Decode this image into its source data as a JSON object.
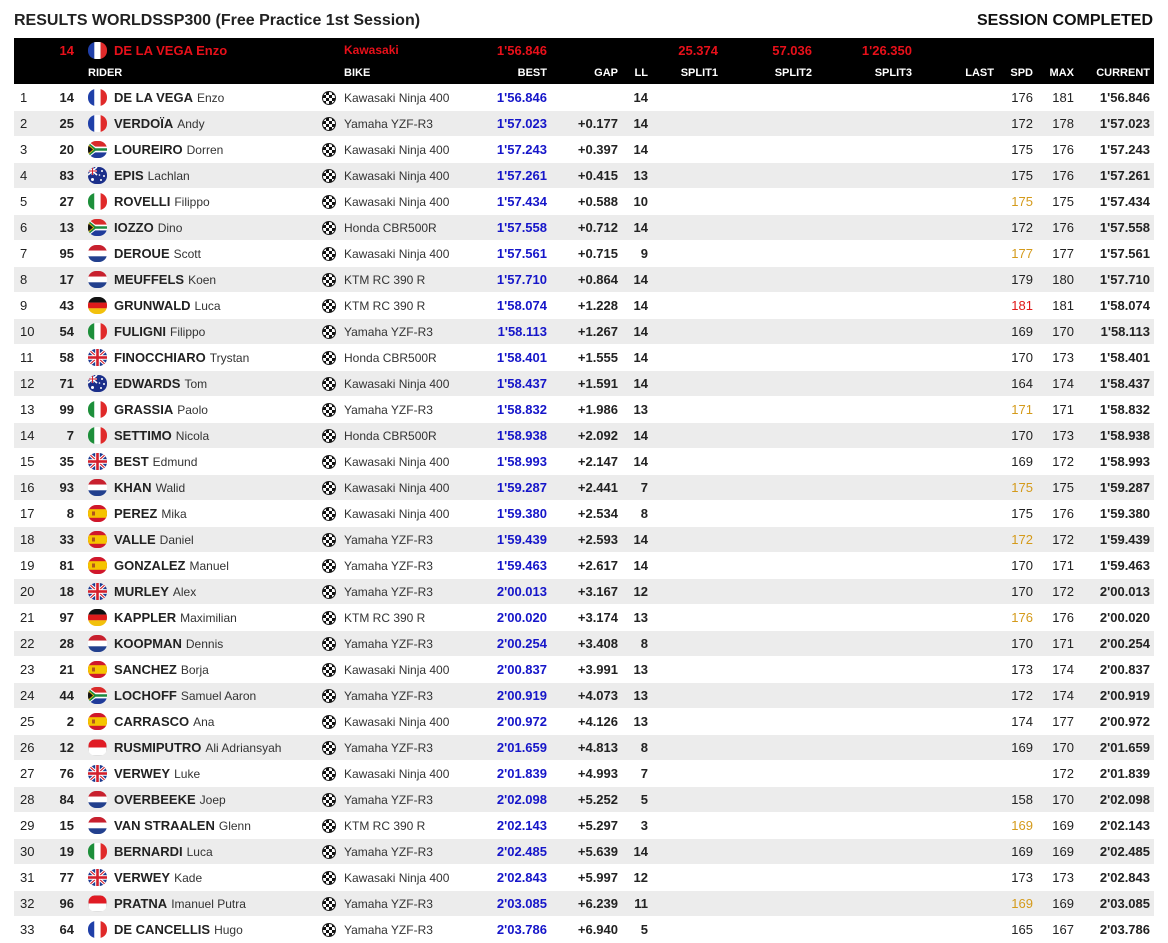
{
  "page": {
    "title": "RESULTS WORLDSSP300 (Free Practice 1st Session)",
    "status": "SESSION COMPLETED"
  },
  "leader": {
    "number": "14",
    "flag": "FRA",
    "rider": "DE LA VEGA Enzo",
    "bike": "Kawasaki",
    "best": "1'56.846",
    "split1": "25.374",
    "split2": "57.036",
    "split3": "1'26.350"
  },
  "columns": {
    "rider": "RIDER",
    "bike": "BIKE",
    "best": "BEST",
    "gap": "GAP",
    "ll": "LL",
    "split1": "SPLIT1",
    "split2": "SPLIT2",
    "split3": "SPLIT3",
    "last": "LAST",
    "spd": "SPD",
    "max": "MAX",
    "current": "CURRENT"
  },
  "colors": {
    "speed_orange": "#d49a1a",
    "speed_red": "#e01818",
    "best_blue": "#1515c9",
    "leader_red": "#e8101a"
  },
  "rows": [
    {
      "pos": "1",
      "num": "14",
      "flag": "FRA",
      "surname": "DE LA VEGA",
      "firstname": "Enzo",
      "bike": "Kawasaki Ninja 400",
      "best": "1'56.846",
      "gap": "",
      "ll": "14",
      "spd": "176",
      "spd_color": "",
      "max": "181",
      "current": "1'56.846"
    },
    {
      "pos": "2",
      "num": "25",
      "flag": "FRA",
      "surname": "VERDOÏA",
      "firstname": "Andy",
      "bike": "Yamaha YZF-R3",
      "best": "1'57.023",
      "gap": "+0.177",
      "ll": "14",
      "spd": "172",
      "spd_color": "",
      "max": "178",
      "current": "1'57.023"
    },
    {
      "pos": "3",
      "num": "20",
      "flag": "RSA",
      "surname": "LOUREIRO",
      "firstname": "Dorren",
      "bike": "Kawasaki Ninja 400",
      "best": "1'57.243",
      "gap": "+0.397",
      "ll": "14",
      "spd": "175",
      "spd_color": "",
      "max": "176",
      "current": "1'57.243"
    },
    {
      "pos": "4",
      "num": "83",
      "flag": "AUS",
      "surname": "EPIS",
      "firstname": "Lachlan",
      "bike": "Kawasaki Ninja 400",
      "best": "1'57.261",
      "gap": "+0.415",
      "ll": "13",
      "spd": "175",
      "spd_color": "",
      "max": "176",
      "current": "1'57.261"
    },
    {
      "pos": "5",
      "num": "27",
      "flag": "ITA",
      "surname": "ROVELLI",
      "firstname": "Filippo",
      "bike": "Kawasaki Ninja 400",
      "best": "1'57.434",
      "gap": "+0.588",
      "ll": "10",
      "spd": "175",
      "spd_color": "orange",
      "max": "175",
      "current": "1'57.434"
    },
    {
      "pos": "6",
      "num": "13",
      "flag": "RSA",
      "surname": "IOZZO",
      "firstname": "Dino",
      "bike": "Honda CBR500R",
      "best": "1'57.558",
      "gap": "+0.712",
      "ll": "14",
      "spd": "172",
      "spd_color": "",
      "max": "176",
      "current": "1'57.558"
    },
    {
      "pos": "7",
      "num": "95",
      "flag": "NED",
      "surname": "DEROUE",
      "firstname": "Scott",
      "bike": "Kawasaki Ninja 400",
      "best": "1'57.561",
      "gap": "+0.715",
      "ll": "9",
      "spd": "177",
      "spd_color": "orange",
      "max": "177",
      "current": "1'57.561"
    },
    {
      "pos": "8",
      "num": "17",
      "flag": "NED",
      "surname": "MEUFFELS",
      "firstname": "Koen",
      "bike": "KTM RC 390 R",
      "best": "1'57.710",
      "gap": "+0.864",
      "ll": "14",
      "spd": "179",
      "spd_color": "",
      "max": "180",
      "current": "1'57.710"
    },
    {
      "pos": "9",
      "num": "43",
      "flag": "GER",
      "surname": "GRUNWALD",
      "firstname": "Luca",
      "bike": "KTM RC 390 R",
      "best": "1'58.074",
      "gap": "+1.228",
      "ll": "14",
      "spd": "181",
      "spd_color": "red",
      "max": "181",
      "current": "1'58.074"
    },
    {
      "pos": "10",
      "num": "54",
      "flag": "ITA",
      "surname": "FULIGNI",
      "firstname": "Filippo",
      "bike": "Yamaha YZF-R3",
      "best": "1'58.113",
      "gap": "+1.267",
      "ll": "14",
      "spd": "169",
      "spd_color": "",
      "max": "170",
      "current": "1'58.113"
    },
    {
      "pos": "11",
      "num": "58",
      "flag": "GBR",
      "surname": "FINOCCHIARO",
      "firstname": "Trystan",
      "bike": "Honda CBR500R",
      "best": "1'58.401",
      "gap": "+1.555",
      "ll": "14",
      "spd": "170",
      "spd_color": "",
      "max": "173",
      "current": "1'58.401"
    },
    {
      "pos": "12",
      "num": "71",
      "flag": "AUS",
      "surname": "EDWARDS",
      "firstname": "Tom",
      "bike": "Kawasaki Ninja 400",
      "best": "1'58.437",
      "gap": "+1.591",
      "ll": "14",
      "spd": "164",
      "spd_color": "",
      "max": "174",
      "current": "1'58.437"
    },
    {
      "pos": "13",
      "num": "99",
      "flag": "ITA",
      "surname": "GRASSIA",
      "firstname": "Paolo",
      "bike": "Yamaha YZF-R3",
      "best": "1'58.832",
      "gap": "+1.986",
      "ll": "13",
      "spd": "171",
      "spd_color": "orange",
      "max": "171",
      "current": "1'58.832"
    },
    {
      "pos": "14",
      "num": "7",
      "flag": "ITA",
      "surname": "SETTIMO",
      "firstname": "Nicola",
      "bike": "Honda CBR500R",
      "best": "1'58.938",
      "gap": "+2.092",
      "ll": "14",
      "spd": "170",
      "spd_color": "",
      "max": "173",
      "current": "1'58.938"
    },
    {
      "pos": "15",
      "num": "35",
      "flag": "GBR",
      "surname": "BEST",
      "firstname": "Edmund",
      "bike": "Kawasaki Ninja 400",
      "best": "1'58.993",
      "gap": "+2.147",
      "ll": "14",
      "spd": "169",
      "spd_color": "",
      "max": "172",
      "current": "1'58.993"
    },
    {
      "pos": "16",
      "num": "93",
      "flag": "NED",
      "surname": "KHAN",
      "firstname": "Walid",
      "bike": "Kawasaki Ninja 400",
      "best": "1'59.287",
      "gap": "+2.441",
      "ll": "7",
      "spd": "175",
      "spd_color": "orange",
      "max": "175",
      "current": "1'59.287"
    },
    {
      "pos": "17",
      "num": "8",
      "flag": "ESP",
      "surname": "PEREZ",
      "firstname": "Mika",
      "bike": "Kawasaki Ninja 400",
      "best": "1'59.380",
      "gap": "+2.534",
      "ll": "8",
      "spd": "175",
      "spd_color": "",
      "max": "176",
      "current": "1'59.380"
    },
    {
      "pos": "18",
      "num": "33",
      "flag": "ESP",
      "surname": "VALLE",
      "firstname": "Daniel",
      "bike": "Yamaha YZF-R3",
      "best": "1'59.439",
      "gap": "+2.593",
      "ll": "14",
      "spd": "172",
      "spd_color": "orange",
      "max": "172",
      "current": "1'59.439"
    },
    {
      "pos": "19",
      "num": "81",
      "flag": "ESP",
      "surname": "GONZALEZ",
      "firstname": "Manuel",
      "bike": "Yamaha YZF-R3",
      "best": "1'59.463",
      "gap": "+2.617",
      "ll": "14",
      "spd": "170",
      "spd_color": "",
      "max": "171",
      "current": "1'59.463"
    },
    {
      "pos": "20",
      "num": "18",
      "flag": "GBR",
      "surname": "MURLEY",
      "firstname": "Alex",
      "bike": "Yamaha YZF-R3",
      "best": "2'00.013",
      "gap": "+3.167",
      "ll": "12",
      "spd": "170",
      "spd_color": "",
      "max": "172",
      "current": "2'00.013"
    },
    {
      "pos": "21",
      "num": "97",
      "flag": "GER",
      "surname": "KAPPLER",
      "firstname": "Maximilian",
      "bike": "KTM RC 390 R",
      "best": "2'00.020",
      "gap": "+3.174",
      "ll": "13",
      "spd": "176",
      "spd_color": "orange",
      "max": "176",
      "current": "2'00.020"
    },
    {
      "pos": "22",
      "num": "28",
      "flag": "NED",
      "surname": "KOOPMAN",
      "firstname": "Dennis",
      "bike": "Yamaha YZF-R3",
      "best": "2'00.254",
      "gap": "+3.408",
      "ll": "8",
      "spd": "170",
      "spd_color": "",
      "max": "171",
      "current": "2'00.254"
    },
    {
      "pos": "23",
      "num": "21",
      "flag": "ESP",
      "surname": "SANCHEZ",
      "firstname": "Borja",
      "bike": "Kawasaki Ninja 400",
      "best": "2'00.837",
      "gap": "+3.991",
      "ll": "13",
      "spd": "173",
      "spd_color": "",
      "max": "174",
      "current": "2'00.837"
    },
    {
      "pos": "24",
      "num": "44",
      "flag": "RSA",
      "surname": "LOCHOFF",
      "firstname": "Samuel Aaron",
      "bike": "Yamaha YZF-R3",
      "best": "2'00.919",
      "gap": "+4.073",
      "ll": "13",
      "spd": "172",
      "spd_color": "",
      "max": "174",
      "current": "2'00.919"
    },
    {
      "pos": "25",
      "num": "2",
      "flag": "ESP",
      "surname": "CARRASCO",
      "firstname": "Ana",
      "bike": "Kawasaki Ninja 400",
      "best": "2'00.972",
      "gap": "+4.126",
      "ll": "13",
      "spd": "174",
      "spd_color": "",
      "max": "177",
      "current": "2'00.972"
    },
    {
      "pos": "26",
      "num": "12",
      "flag": "INA",
      "surname": "RUSMIPUTRO",
      "firstname": "Ali Adriansyah",
      "bike": "Yamaha YZF-R3",
      "best": "2'01.659",
      "gap": "+4.813",
      "ll": "8",
      "spd": "169",
      "spd_color": "",
      "max": "170",
      "current": "2'01.659"
    },
    {
      "pos": "27",
      "num": "76",
      "flag": "GBR",
      "surname": "VERWEY",
      "firstname": "Luke",
      "bike": "Kawasaki Ninja 400",
      "best": "2'01.839",
      "gap": "+4.993",
      "ll": "7",
      "spd": "",
      "spd_color": "",
      "max": "172",
      "current": "2'01.839"
    },
    {
      "pos": "28",
      "num": "84",
      "flag": "NED",
      "surname": "OVERBEEKE",
      "firstname": "Joep",
      "bike": "Yamaha YZF-R3",
      "best": "2'02.098",
      "gap": "+5.252",
      "ll": "5",
      "spd": "158",
      "spd_color": "",
      "max": "170",
      "current": "2'02.098"
    },
    {
      "pos": "29",
      "num": "15",
      "flag": "NED",
      "surname": "VAN STRAALEN",
      "firstname": "Glenn",
      "bike": "KTM RC 390 R",
      "best": "2'02.143",
      "gap": "+5.297",
      "ll": "3",
      "spd": "169",
      "spd_color": "orange",
      "max": "169",
      "current": "2'02.143"
    },
    {
      "pos": "30",
      "num": "19",
      "flag": "ITA",
      "surname": "BERNARDI",
      "firstname": "Luca",
      "bike": "Yamaha YZF-R3",
      "best": "2'02.485",
      "gap": "+5.639",
      "ll": "14",
      "spd": "169",
      "spd_color": "",
      "max": "169",
      "current": "2'02.485"
    },
    {
      "pos": "31",
      "num": "77",
      "flag": "GBR",
      "surname": "VERWEY",
      "firstname": "Kade",
      "bike": "Kawasaki Ninja 400",
      "best": "2'02.843",
      "gap": "+5.997",
      "ll": "12",
      "spd": "173",
      "spd_color": "",
      "max": "173",
      "current": "2'02.843"
    },
    {
      "pos": "32",
      "num": "96",
      "flag": "INA",
      "surname": "PRATNA",
      "firstname": "Imanuel Putra",
      "bike": "Yamaha YZF-R3",
      "best": "2'03.085",
      "gap": "+6.239",
      "ll": "11",
      "spd": "169",
      "spd_color": "orange",
      "max": "169",
      "current": "2'03.085"
    },
    {
      "pos": "33",
      "num": "64",
      "flag": "FRA",
      "surname": "DE CANCELLIS",
      "firstname": "Hugo",
      "bike": "Yamaha YZF-R3",
      "best": "2'03.786",
      "gap": "+6.940",
      "ll": "5",
      "spd": "165",
      "spd_color": "",
      "max": "167",
      "current": "2'03.786"
    }
  ]
}
